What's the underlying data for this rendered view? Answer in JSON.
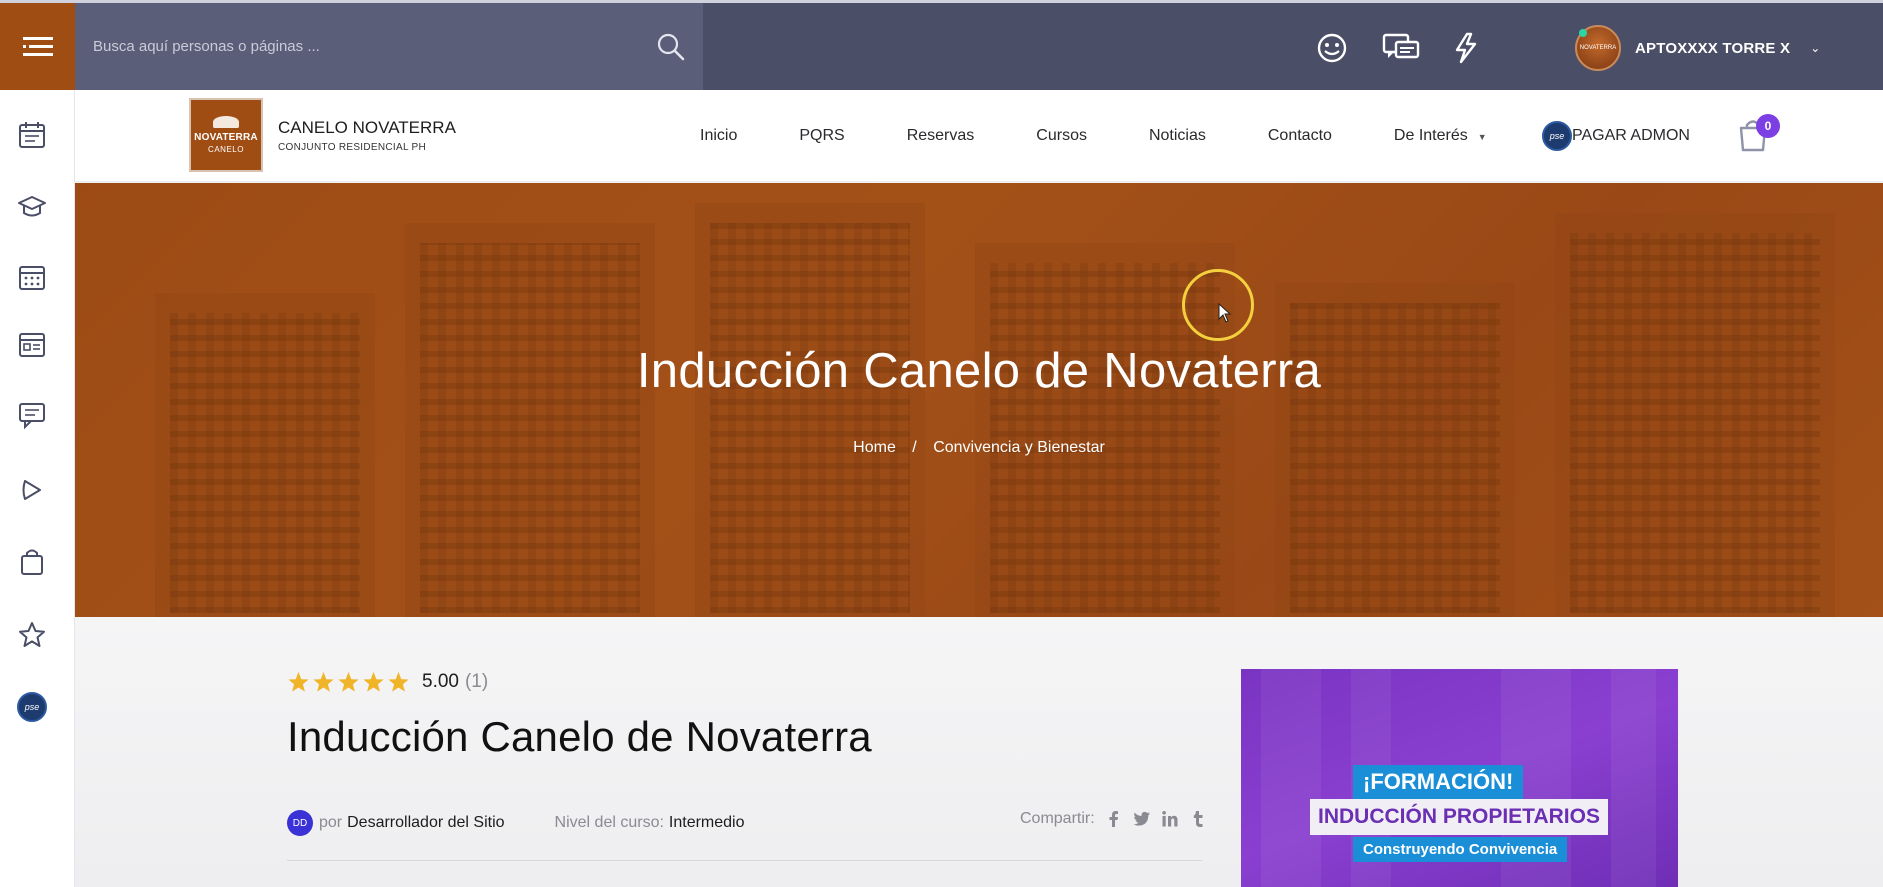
{
  "topbar": {
    "search_placeholder": "Busca aquí personas o páginas ...",
    "user_name": "APTOXXXX TORRE X",
    "avatar_text": "NOVATERRA"
  },
  "header": {
    "logo_line1": "NOVATERRA",
    "logo_line2": "CANELO",
    "site_name": "CANELO NOVATERRA",
    "site_subtitle": "CONJUNTO RESIDENCIAL PH",
    "nav": [
      "Inicio",
      "PQRS",
      "Reservas",
      "Cursos",
      "Noticias",
      "Contacto",
      "De Interés"
    ],
    "pse_label": "pse",
    "pay_label": "PAGAR ADMON",
    "cart_count": "0"
  },
  "hero": {
    "title": "Inducción Canelo de Novaterra",
    "breadcrumb_home": "Home",
    "breadcrumb_sep": "/",
    "breadcrumb_category": "Convivencia y Bienestar"
  },
  "course": {
    "rating_value": "5.00",
    "rating_count": "(1)",
    "rating_stars": 5,
    "title": "Inducción Canelo de Novaterra",
    "author_initials": "DD",
    "author_prefix": "por",
    "author_name": "Desarrollador del Sitio",
    "level_label": "Nivel del curso:",
    "level_value": "Intermedio",
    "share_label": "Compartir:"
  },
  "promo": {
    "line1": "¡FORMACIÓN!",
    "line2": "INDUCCIÓN PROPIETARIOS",
    "line3": "Construyendo Convivencia"
  },
  "colors": {
    "brand_orange": "#a04d14",
    "topbar": "#4a4e66",
    "accent_purple": "#7b3fe4",
    "star": "#f0b429"
  }
}
